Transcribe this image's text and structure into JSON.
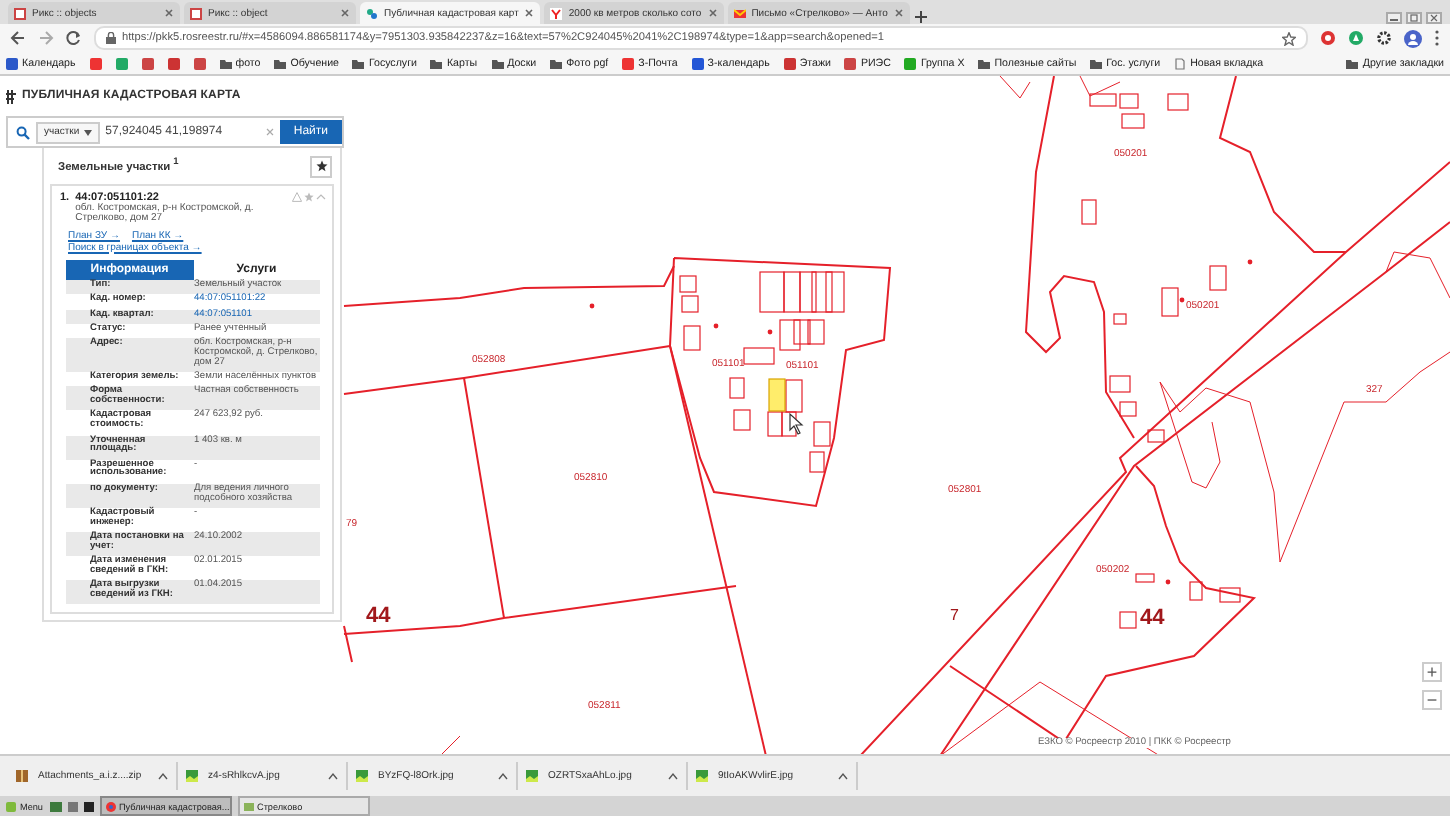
{
  "browser": {
    "tabs": [
      {
        "title": "Рикс :: objects",
        "selected": false
      },
      {
        "title": "Рикс :: object",
        "selected": false
      },
      {
        "title": "Публичная кадастровая карт",
        "selected": true
      },
      {
        "title": "2000 кв метров сколько сото",
        "selected": false
      },
      {
        "title": "Письмо «Стрелково» — Анто",
        "selected": false
      }
    ],
    "address": "https://pkk5.rosreestr.ru/#x=4586094.886581174&y=7951303.935842237&z=16&text=57%2C924045%2041%2C198974&type=1&app=search&opened=1",
    "bookmarks": [
      "Календарь",
      "фото",
      "Обучение",
      "Госуслуги",
      "Карты",
      "Доски",
      "Фото pgf",
      "З-Почта",
      "З-календарь",
      "Этажи",
      "РИЭС",
      "Группа Х",
      "Полезные сайты",
      "Гос. услуги",
      "Новая вкладка"
    ],
    "other_bookmarks": "Другие закладки"
  },
  "panel": {
    "title": "ПУБЛИЧНАЯ КАДАСТРОВАЯ КАРТА",
    "search": {
      "category": "участки",
      "value": "57,924045 41,198974",
      "button": "Найти"
    },
    "results_title": "Земельные участки $^{1}$",
    "item": {
      "index": "1.",
      "number": "44:07:051101:22",
      "address": "обл. Костромская, р-н Костромской, д. Стрелково, дом 27",
      "links": [
        "План ЗУ →",
        "План КК →",
        "Поиск в границах объекта →"
      ],
      "tabs": [
        {
          "label": "Информация",
          "selected": true
        },
        {
          "label": "Услуги",
          "selected": false
        }
      ],
      "rows": [
        {
          "label": "Тип:",
          "value": "Земельный участок",
          "kind": "text"
        },
        {
          "label": "Кад. номер:",
          "value": "44:07:051101:22",
          "kind": "link"
        },
        {
          "label": "Кад. квартал:",
          "value": "44:07:051101",
          "kind": "link"
        },
        {
          "label": "Статус:",
          "value": "Ранее учтенный",
          "kind": "text"
        },
        {
          "label": "Адрес:",
          "value": "обл. Костромская, р-н Костромской, д. Стрелково, дом 27",
          "kind": "text"
        },
        {
          "label": "Категория земель:",
          "value": "Земли населённых пунктов",
          "kind": "text"
        },
        {
          "label": "Форма собственности:",
          "value": "Частная собственность",
          "kind": "text"
        },
        {
          "label": "Кадастровая стоимость:",
          "value": "247 623,92 руб.",
          "kind": "text"
        },
        {
          "label": "Уточненная площадь:",
          "value": "1 403 кв. м",
          "kind": "text"
        },
        {
          "label": "Разрешенное использование:",
          "value": "-",
          "kind": "text"
        },
        {
          "label": "по документу:",
          "value": "Для ведения личного подсобного хозяйства",
          "kind": "text"
        },
        {
          "label": "Кадастровый инженер:",
          "value": "-",
          "kind": "text"
        },
        {
          "label": "Дата постановки на учет:",
          "value": "24.10.2002",
          "kind": "text"
        },
        {
          "label": "Дата изменения сведений в ГКН:",
          "value": "02.01.2015",
          "kind": "text"
        },
        {
          "label": "Дата выгрузки сведений из ГКН:",
          "value": "01.04.2015",
          "kind": "text"
        }
      ]
    }
  },
  "map": {
    "labels": [
      {
        "text": "052808",
        "kind": "block"
      },
      {
        "text": "79",
        "kind": "block"
      },
      {
        "text": "051101",
        "kind": "block"
      },
      {
        "text": "051101",
        "kind": "block"
      },
      {
        "text": "052810",
        "kind": "block"
      },
      {
        "text": "052801",
        "kind": "block"
      },
      {
        "text": "050201",
        "kind": "block"
      },
      {
        "text": "050201",
        "kind": "block"
      },
      {
        "text": "327",
        "kind": "block"
      },
      {
        "text": "050202",
        "kind": "block"
      },
      {
        "text": "44",
        "kind": "district"
      },
      {
        "text": "7",
        "kind": "number"
      },
      {
        "text": "44",
        "kind": "district"
      },
      {
        "text": "052811",
        "kind": "block"
      }
    ],
    "zoom_in": "+",
    "zoom_out": "−",
    "attribution": "ЕЗКО © Росреестр 2010 | ПКК © Росреестр"
  },
  "downloads": [
    {
      "name": "Attachments_a.i.z....zip",
      "kind": "archive"
    },
    {
      "name": "z4-sRhlkcvA.jpg",
      "kind": "image"
    },
    {
      "name": "BYzFQ-l8Ork.jpg",
      "kind": "image"
    },
    {
      "name": "OZRTSxaAhLo.jpg",
      "kind": "image"
    },
    {
      "name": "9tIoAKWvlirE.jpg",
      "kind": "image"
    }
  ],
  "taskbar": {
    "menu": "Menu",
    "windows": [
      {
        "title": "Публичная кадастровая...",
        "selected": true
      },
      {
        "title": "Стрелково",
        "selected": false
      }
    ]
  }
}
